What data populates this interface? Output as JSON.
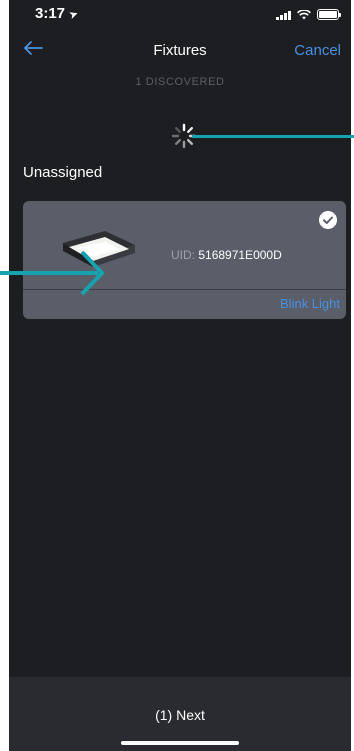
{
  "status_bar": {
    "time": "3:17"
  },
  "nav": {
    "title": "Fixtures",
    "cancel_label": "Cancel"
  },
  "discovered_text": "1 DISCOVERED",
  "section": {
    "title": "Unassigned"
  },
  "fixture": {
    "uid_label": "UID:",
    "uid_value": "5168971E000D",
    "blink_label": "Blink Light"
  },
  "footer": {
    "next_label": "(1) Next"
  },
  "colors": {
    "accent": "#4a90e2",
    "background": "#1d1e22",
    "card": "#595e68",
    "annotation": "#16a3b0"
  }
}
